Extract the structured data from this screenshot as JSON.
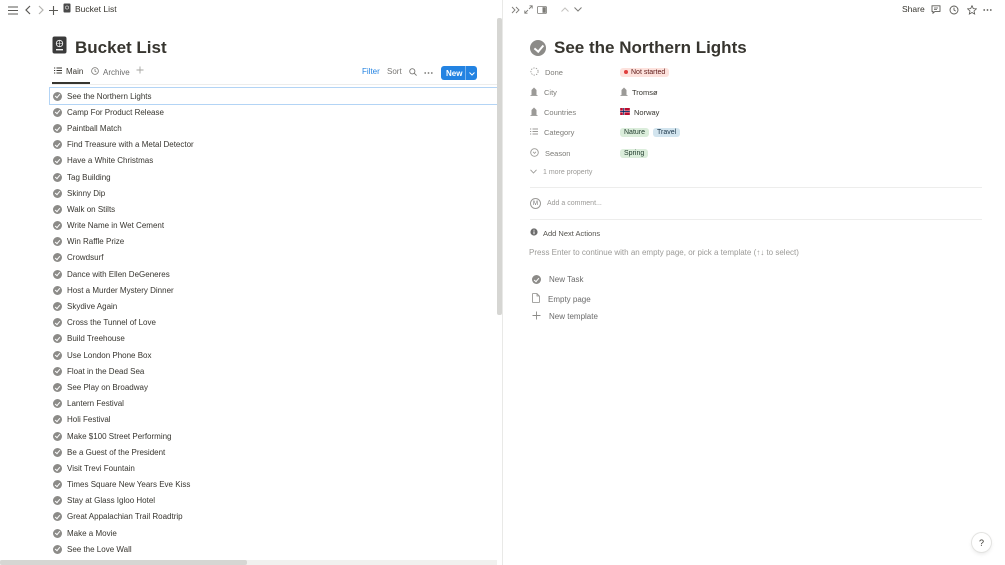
{
  "topbar": {
    "breadcrumb": "Bucket List"
  },
  "database": {
    "title": "Bucket List",
    "views": [
      {
        "label": "Main"
      },
      {
        "label": "Archive"
      }
    ],
    "filter_label": "Filter",
    "sort_label": "Sort",
    "new_label": "New"
  },
  "items": [
    "See the Northern Lights",
    "Camp For Product Release",
    "Paintball Match",
    "Find Treasure with a Metal Detector",
    "Have a White Christmas",
    "Tag Building",
    "Skinny Dip",
    "Walk on Stilts",
    "Write Name in Wet Cement",
    "Win Raffle Prize",
    "Crowdsurf",
    "Dance with Ellen DeGeneres",
    "Host a Murder Mystery Dinner",
    "Skydive Again",
    "Cross the Tunnel of Love",
    "Build Treehouse",
    "Use London Phone Box",
    "Float in the Dead Sea",
    "See Play on Broadway",
    "Lantern Festival",
    "Holi Festival",
    "Make $100 Street Performing",
    "Be a Guest of the President",
    "Visit Trevi Fountain",
    "Times Square New Years Eve Kiss",
    "Stay at Glass Igloo Hotel",
    "Great Appalachian Trail Roadtrip",
    "Make a Movie",
    "See the Love Wall"
  ],
  "detail": {
    "share_label": "Share",
    "title": "See the Northern Lights",
    "properties": {
      "done": {
        "name": "Done",
        "value": "Not started"
      },
      "city": {
        "name": "City",
        "value": "Tromsø"
      },
      "countries": {
        "name": "Countries",
        "value": "Norway"
      },
      "category": {
        "name": "Category",
        "values": [
          "Nature",
          "Travel"
        ]
      },
      "season": {
        "name": "Season",
        "value": "Spring"
      }
    },
    "more_property": "1 more property",
    "comment_placeholder": "Add a comment...",
    "avatar_letter": "M",
    "next_actions": "Add Next Actions",
    "hint": "Press Enter to continue with an empty page, or pick a template (↑↓ to select)",
    "templates": [
      "New Task",
      "Empty page",
      "New template"
    ],
    "help": "?"
  },
  "colors": {
    "accent": "#2383e2",
    "not_started": "#fde2dd",
    "green_tag": "#dbeddb",
    "blue_tag": "#d3e5ef"
  }
}
